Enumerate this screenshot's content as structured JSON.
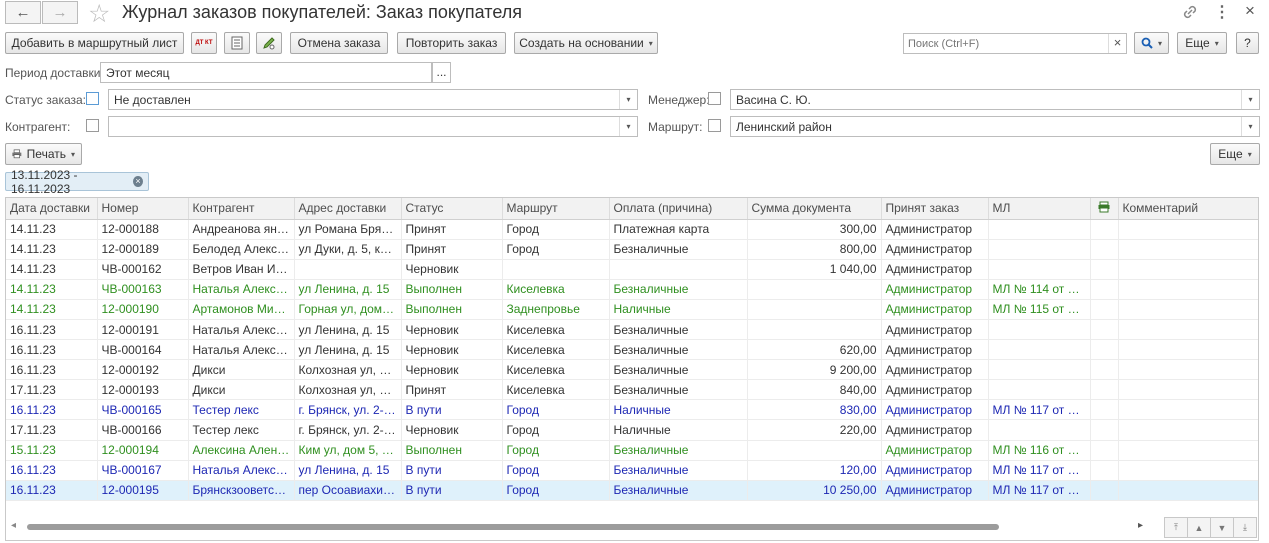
{
  "window": {
    "back_glyph": "←",
    "forward_glyph": "→",
    "star_glyph": "☆",
    "title": "Журнал заказов покупателей: Заказ покупателя",
    "link_glyph": "🔗",
    "more_glyph": "⋮",
    "close_glyph": "×"
  },
  "toolbar": {
    "add_route_label": "Добавить в маршрутный лист",
    "dt_kt_label": "ДТ КТ",
    "cancel_order_label": "Отмена заказа",
    "repeat_order_label": "Повторить заказ",
    "create_based_label": "Создать на основании",
    "search_placeholder": "Поиск (Ctrl+F)",
    "clear_glyph": "×",
    "search_btn_glyph": "🔍",
    "more_label": "Еще",
    "help_label": "?"
  },
  "filters": {
    "period_label": "Период доставки:",
    "period_value": "Этот месяц",
    "period_btn": "...",
    "status_label": "Статус заказа:",
    "status_value": "Не доставлен",
    "manager_label": "Менеджер:",
    "manager_value": "Васина С. Ю.",
    "counterparty_label": "Контрагент:",
    "counterparty_value": "",
    "route_label": "Маршрут:",
    "route_value": "Ленинский район"
  },
  "print": {
    "label": "Печать",
    "more_label": "Еще"
  },
  "date_filter_chip": "13.11.2023 - 16.11.2023",
  "table": {
    "columns": [
      "Дата доставки",
      "Номер",
      "Контрагент",
      "Адрес доставки",
      "Статус",
      "Маршрут",
      "Оплата (причина)",
      "Сумма документа",
      "Принят заказ",
      "МЛ",
      "",
      "Комментарий"
    ],
    "rows": [
      {
        "style": "black",
        "cells": [
          "14.11.23",
          "12-000188",
          "Андреанова яна…",
          "ул Романа Брян…",
          "Принят",
          "Город",
          "Платежная карта",
          "300,00",
          "Администратор",
          "",
          "",
          ""
        ]
      },
      {
        "style": "black",
        "cells": [
          "14.11.23",
          "12-000189",
          "Белодед Алекс…",
          "ул Дуки,  д. 5,  к…",
          "Принят",
          "Город",
          "Безналичные",
          "800,00",
          "Администратор",
          "",
          "",
          ""
        ]
      },
      {
        "style": "black",
        "cells": [
          "14.11.23",
          "ЧВ-000162",
          "Ветров Иван Ив…",
          "",
          "Черновик",
          "",
          "",
          "1 040,00",
          "Администратор",
          "",
          "",
          ""
        ]
      },
      {
        "style": "green",
        "cells": [
          "14.11.23",
          "ЧВ-000163",
          "Наталья Алекса…",
          "ул Ленина,  д. 15",
          "Выполнен",
          "Киселевка",
          "Безналичные",
          "",
          "Администратор",
          "МЛ № 114 от 14.…",
          "",
          ""
        ]
      },
      {
        "style": "green",
        "cells": [
          "14.11.23",
          "12-000190",
          "Артамонов Миха…",
          "Горная ул,  дом …",
          "Выполнен",
          "Заднепровье",
          "Наличные",
          "",
          "Администратор",
          "МЛ № 115 от 14.…",
          "",
          ""
        ]
      },
      {
        "style": "black",
        "cells": [
          "16.11.23",
          "12-000191",
          "Наталья Алекса…",
          "ул Ленина,  д. 15",
          "Черновик",
          "Киселевка",
          "Безналичные",
          "",
          "Администратор",
          "",
          "",
          ""
        ]
      },
      {
        "style": "black",
        "cells": [
          "16.11.23",
          "ЧВ-000164",
          "Наталья Алекса…",
          "ул Ленина,  д. 15",
          "Черновик",
          "Киселевка",
          "Безналичные",
          "620,00",
          "Администратор",
          "",
          "",
          ""
        ]
      },
      {
        "style": "black",
        "cells": [
          "16.11.23",
          "12-000192",
          "Дикси",
          "Колхозная ул, …",
          "Черновик",
          "Киселевка",
          "Безналичные",
          "9 200,00",
          "Администратор",
          "",
          "",
          ""
        ]
      },
      {
        "style": "black",
        "cells": [
          "17.11.23",
          "12-000193",
          "Дикси",
          "Колхозная ул,  …",
          "Принят",
          "Киселевка",
          "Безналичные",
          "840,00",
          "Администратор",
          "",
          "",
          ""
        ]
      },
      {
        "style": "blue",
        "cells": [
          "16.11.23",
          "ЧВ-000165",
          "Тестер лекс",
          "г. Брянск, ул. 2-…",
          "В пути",
          "Город",
          "Наличные",
          "830,00",
          "Администратор",
          "МЛ № 117 от 16.…",
          "",
          ""
        ]
      },
      {
        "style": "black",
        "cells": [
          "17.11.23",
          "ЧВ-000166",
          "Тестер лекс",
          "г. Брянск, ул. 2-…",
          "Черновик",
          "Город",
          "Наличные",
          "220,00",
          "Администратор",
          "",
          "",
          ""
        ]
      },
      {
        "style": "green",
        "cells": [
          "15.11.23",
          "12-000194",
          "Алексина Алена…",
          "Ким ул,  дом 5, …",
          "Выполнен",
          "Город",
          "Безналичные",
          "",
          "Администратор",
          "МЛ № 116 от 15.…",
          "",
          ""
        ]
      },
      {
        "style": "blue",
        "cells": [
          "16.11.23",
          "ЧВ-000167",
          "Наталья Алекса…",
          "ул Ленина,  д. 15",
          "В пути",
          "Город",
          "Безналичные",
          "120,00",
          "Администратор",
          "МЛ № 117 от 16.…",
          "",
          ""
        ]
      },
      {
        "style": "blue-sel",
        "cells": [
          "16.11.23",
          "12-000195",
          "Брянскзооветснаб",
          "пер Осоавиахим…",
          "В пути",
          "Город",
          "Безналичные",
          "10 250,00",
          "Администратор",
          "МЛ № 117 от 16.…",
          "",
          ""
        ]
      }
    ]
  },
  "scroll": {
    "left_glyph": "◂",
    "right_glyph": "▸",
    "position": 0.0,
    "visible_fraction": 0.88
  },
  "nav": {
    "first_glyph": "⤒",
    "up_glyph": "▲",
    "down_glyph": "▼",
    "last_glyph": "⤓"
  },
  "colors": {
    "accent_blue": "#1d27b3",
    "done_green": "#2f8f1f",
    "selection": "#dff1fb",
    "chip_bg": "#e3eef6"
  }
}
